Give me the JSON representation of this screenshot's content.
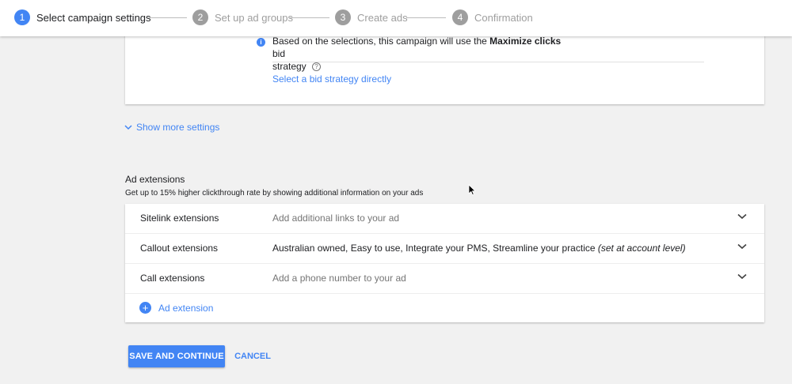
{
  "stepper": {
    "steps": [
      {
        "num": "1",
        "label": "Select campaign settings"
      },
      {
        "num": "2",
        "label": "Set up ad groups"
      },
      {
        "num": "3",
        "label": "Create ads"
      },
      {
        "num": "4",
        "label": "Confirmation"
      }
    ]
  },
  "bid": {
    "info_prefix": "Based on the selections, this campaign will use the",
    "info_strong": "Maximize clicks",
    "info_suffix": "bid",
    "info_line2": "strategy",
    "help_glyph": "?",
    "link": "Select a bid strategy directly"
  },
  "show_more": {
    "label": "Show more settings"
  },
  "extensions": {
    "title": "Ad extensions",
    "subtitle": "Get up to 15% higher clickthrough rate by showing additional information on your ads",
    "rows": [
      {
        "name": "Sitelink extensions",
        "value": "Add additional links to your ad"
      },
      {
        "name": "Callout extensions",
        "value": "Australian owned, Easy to use, Integrate your PMS, Streamline your practice",
        "level": "(set at account level)"
      },
      {
        "name": "Call extensions",
        "value": "Add a phone number to your ad"
      }
    ],
    "add_label": "Ad extension",
    "add_glyph": "+"
  },
  "actions": {
    "save": "SAVE AND CONTINUE",
    "cancel": "CANCEL"
  },
  "colors": {
    "accent": "#4285f4",
    "inactive_step": "#9e9e9e",
    "background": "#f1f1f1"
  }
}
